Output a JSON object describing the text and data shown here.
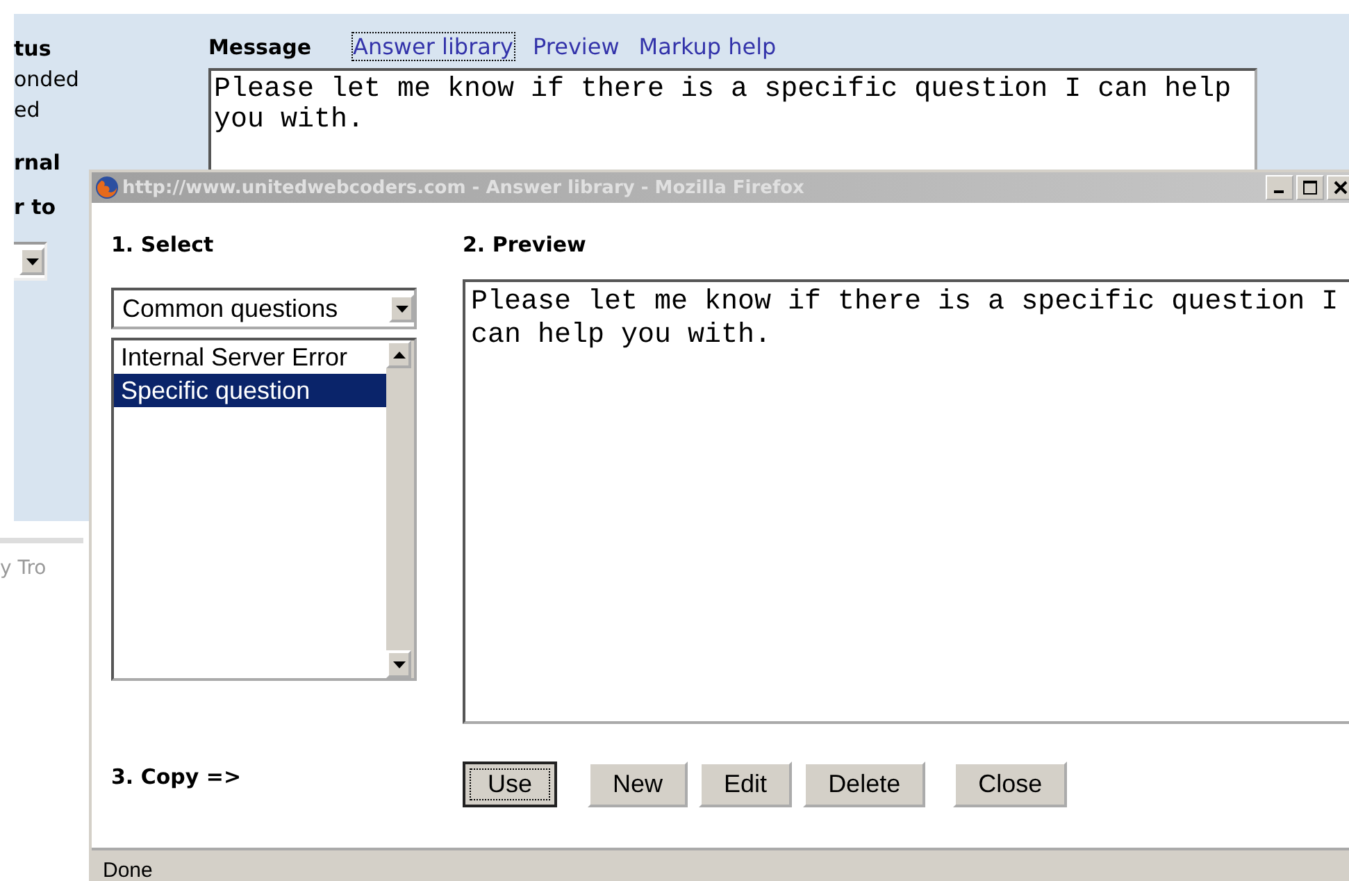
{
  "background_page": {
    "left_column": [
      {
        "kind": "heading",
        "text": "tus"
      },
      {
        "kind": "text",
        "text": "onded"
      },
      {
        "kind": "text",
        "text": "ed"
      },
      {
        "kind": "heading",
        "text": "rnal"
      },
      {
        "kind": "heading",
        "text": "r to"
      },
      {
        "kind": "dropdown"
      }
    ],
    "message_label": "Message",
    "links": [
      {
        "label": "Answer library",
        "focused": true
      },
      {
        "label": "Preview",
        "focused": false
      },
      {
        "label": "Markup help",
        "focused": false
      }
    ],
    "message_value": "Please let me know if there is a specific question I can help you with.",
    "footer_text": "y Tro"
  },
  "popup": {
    "window": {
      "title": "http://www.unitedwebcoders.com - Answer library - Mozilla Firefox",
      "active": false
    },
    "select_heading": "1. Select",
    "category_dropdown": {
      "value": "Common questions"
    },
    "answers": [
      {
        "label": "Internal Server Error",
        "selected": false
      },
      {
        "label": "Specific question",
        "selected": true
      }
    ],
    "copy_label": "3. Copy =>",
    "preview_heading": "2. Preview",
    "preview_value": "Please let me know if there is a specific question I can help you with.",
    "buttons": [
      {
        "label": "Use",
        "focused": true
      },
      {
        "label": "New",
        "focused": false
      },
      {
        "label": "Edit",
        "focused": false
      },
      {
        "label": "Delete",
        "focused": false
      },
      {
        "label": "Close",
        "focused": false
      }
    ],
    "status_bar": "Done"
  }
}
